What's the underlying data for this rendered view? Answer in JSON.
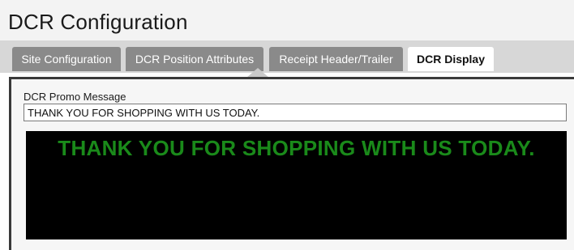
{
  "page": {
    "title": "DCR Configuration"
  },
  "tabs": [
    {
      "label": "Site Configuration",
      "active": false
    },
    {
      "label": "DCR Position Attributes",
      "active": false
    },
    {
      "label": "Receipt Header/Trailer",
      "active": false
    },
    {
      "label": "DCR Display",
      "active": true
    }
  ],
  "form": {
    "promo_label": "DCR Promo Message",
    "promo_value": "THANK YOU FOR SHOPPING WITH US TODAY."
  },
  "display": {
    "text": "THANK YOU FOR SHOPPING WITH US TODAY.",
    "text_color": "#1a8a1a",
    "background_color": "#000000"
  },
  "colors": {
    "tab_inactive": "#8a8a8a",
    "tab_active": "#ffffff",
    "panel_border": "#3a3a3a"
  }
}
